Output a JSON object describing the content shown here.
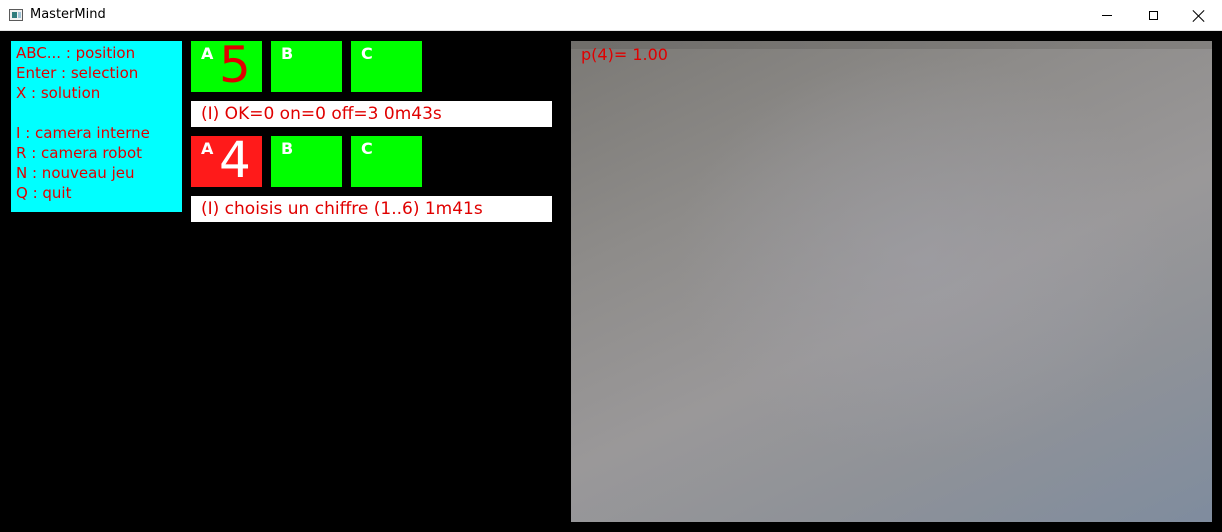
{
  "window": {
    "title": "MasterMind"
  },
  "help": {
    "lines": [
      "ABC... : position",
      "Enter : selection",
      "X : solution",
      "I : camera interne",
      "R : camera robot",
      "N : nouveau jeu",
      "Q : quit"
    ]
  },
  "rows": [
    {
      "slots": [
        {
          "letter": "A",
          "digit": "5",
          "color": "green"
        },
        {
          "letter": "B",
          "digit": "",
          "color": "green"
        },
        {
          "letter": "C",
          "digit": "",
          "color": "green"
        }
      ],
      "status": "(I) OK=0 on=0 off=3 0m43s"
    },
    {
      "slots": [
        {
          "letter": "A",
          "digit": "4",
          "color": "red"
        },
        {
          "letter": "B",
          "digit": "",
          "color": "green"
        },
        {
          "letter": "C",
          "digit": "",
          "color": "green"
        }
      ],
      "status": "(I) choisis un chiffre (1..6) 1m41s"
    }
  ],
  "camera": {
    "overlay": "p(4)= 1.00"
  },
  "colors": {
    "help_bg": "#00ffff",
    "slot_green": "#00ff00",
    "slot_red": "#ff1a1a",
    "text_red": "#e00000"
  }
}
